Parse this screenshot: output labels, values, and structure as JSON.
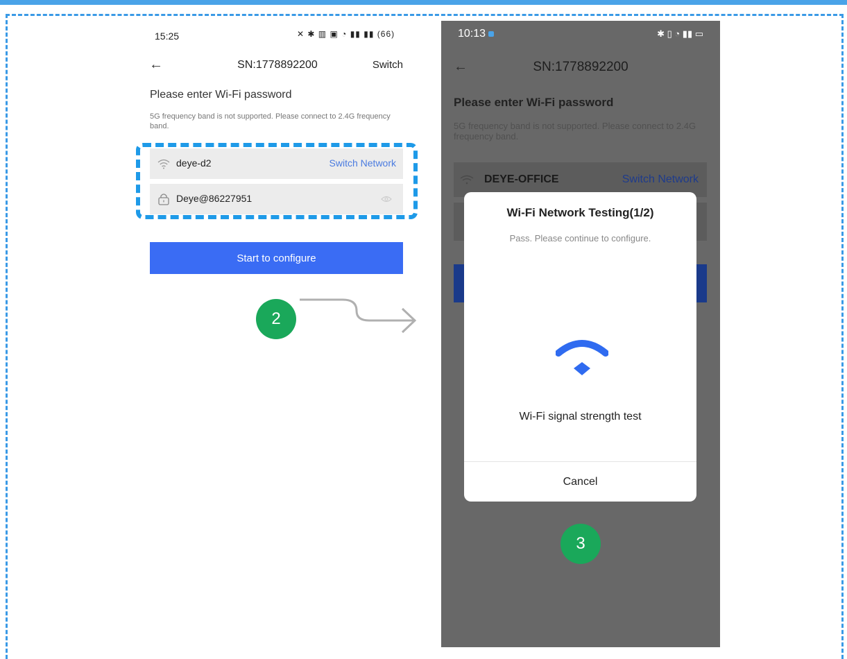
{
  "left_phone": {
    "status_time": "15:25",
    "status_icons": "✕ ✱ ▥ ▣ ◔ ▮▮ ▮▮ (66)",
    "header": {
      "title": "SN:1778892200",
      "switch_label": "Switch"
    },
    "heading": "Please enter Wi-Fi password",
    "hint": "5G frequency band is not supported. Please connect to 2.4G frequency band.",
    "network": {
      "icon": "wifi-icon",
      "ssid": "deye-d2",
      "switch_link": "Switch Network"
    },
    "password": {
      "icon": "lock-icon",
      "value": "Deye@86227951",
      "toggle_icon": "eye-icon"
    },
    "configure_button": "Start to configure"
  },
  "step_2": "2",
  "right_phone": {
    "status_time": "10:13",
    "status_icons": "✱ ▯ ◔ ▮▮ ▭",
    "header": {
      "title": "SN:1778892200"
    },
    "heading": "Please enter Wi-Fi password",
    "hint": "5G frequency band is not supported. Please connect to 2.4G frequency band.",
    "network": {
      "ssid": "DEYE-OFFICE",
      "switch_link": "Switch Network"
    },
    "modal": {
      "title": "Wi-Fi Network Testing(1/2)",
      "subtitle": "Pass. Please continue to configure.",
      "icon": "wifi-icon",
      "label": "Wi-Fi signal strength test",
      "cancel": "Cancel"
    }
  },
  "step_3": "3",
  "colors": {
    "accent": "#3a6cf4",
    "step": "#1aa85a",
    "highlight_dash": "#1e9ae8",
    "link": "#4a7be0"
  }
}
